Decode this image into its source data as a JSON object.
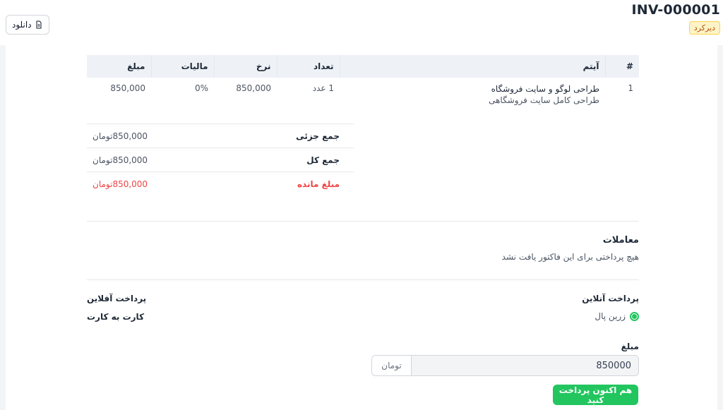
{
  "header": {
    "invoice_number": "INV-000001",
    "status": "دیرکرد",
    "download_label": "دانلود"
  },
  "items_table": {
    "columns": [
      "#",
      "آیتم",
      "تعداد",
      "نرخ",
      "مالیات",
      "مبلغ"
    ],
    "rows": [
      {
        "index": "1",
        "name": "طراحی لوگو و سایت فروشگاه",
        "description": "طراحی کامل سایت فروشگاهی",
        "quantity": "1 عدد",
        "rate": "850,000",
        "tax": "0%",
        "amount": "850,000"
      }
    ]
  },
  "totals": {
    "subtotal_label": "جمع جزئی",
    "subtotal_value": "850,000تومان",
    "total_label": "جمع کل",
    "total_value": "850,000تومان",
    "due_label": "مبلغ مانده",
    "due_value": "850,000تومان"
  },
  "transactions": {
    "title": "معاملات",
    "empty_text": "هیچ پرداختی برای این فاکتور یافت نشد"
  },
  "payment": {
    "online_title": "پرداخت آنلاین",
    "gateway_label": "زرین پال",
    "offline_title": "پرداخت آفلاین",
    "offline_method": "کارت به کارت",
    "amount_label": "مبلغ",
    "amount_value": "850000",
    "currency_suffix": "تومان",
    "pay_button": "هم اکنون پرداخت کنید"
  },
  "colors": {
    "accent_green": "#22c55e",
    "due_red": "#ef4444",
    "badge_bg": "#fef3c7"
  }
}
